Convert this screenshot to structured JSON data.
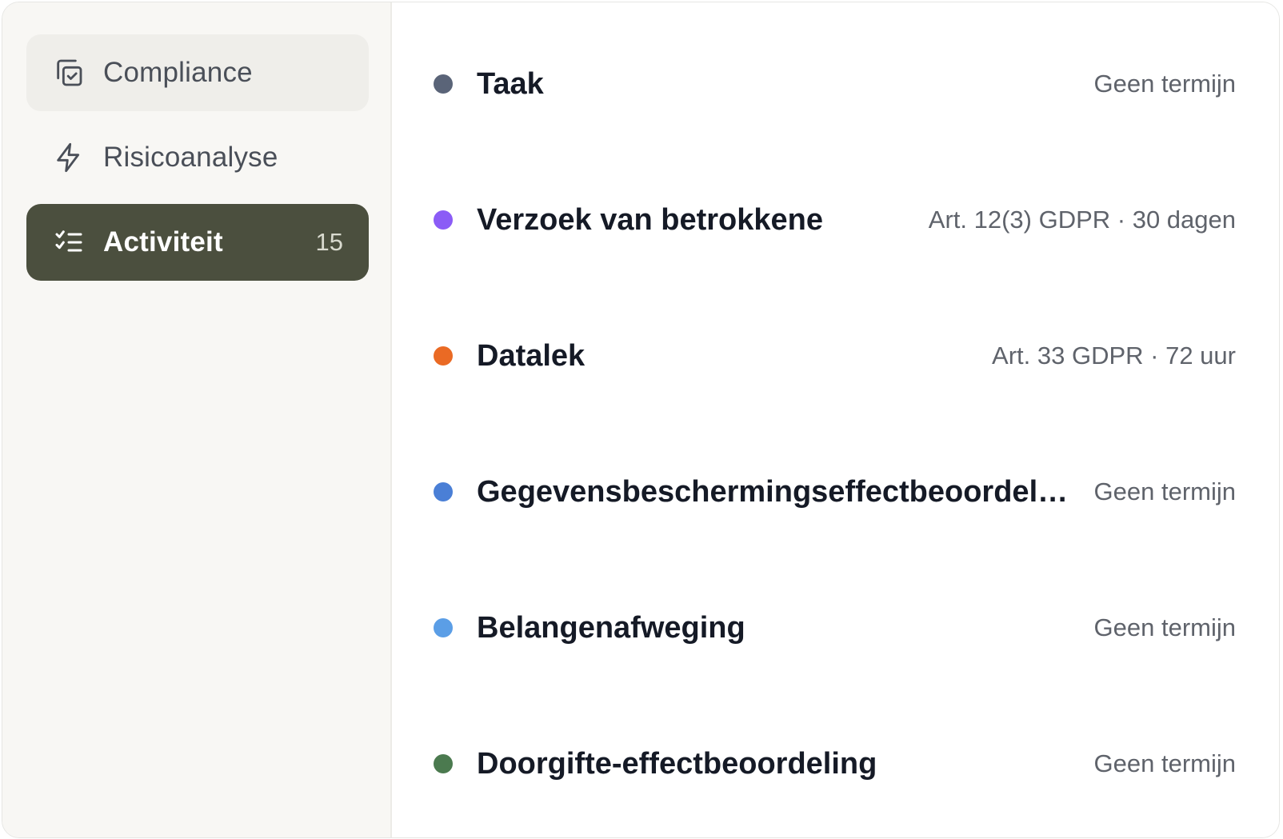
{
  "sidebar": {
    "items": [
      {
        "label": "Compliance",
        "icon": "checklist-copy-icon",
        "state": "hover"
      },
      {
        "label": "Risicoanalyse",
        "icon": "lightning-icon",
        "state": "default"
      },
      {
        "label": "Activiteit",
        "icon": "list-check-icon",
        "state": "active",
        "count": "15"
      }
    ]
  },
  "activity_types": [
    {
      "title": "Taak",
      "meta": "Geen termijn",
      "color": "#5a6478"
    },
    {
      "title": "Verzoek van betrokkene",
      "meta": "Art. 12(3) GDPR · 30 dagen",
      "color": "#8b5cf6"
    },
    {
      "title": "Datalek",
      "meta": "Art. 33 GDPR · 72 uur",
      "color": "#ea6a24"
    },
    {
      "title": "Gegevensbeschermingseffectbeoordeling",
      "meta": "Geen termijn",
      "color": "#4a7fd6"
    },
    {
      "title": "Belangenafweging",
      "meta": "Geen termijn",
      "color": "#5b9ee6"
    },
    {
      "title": "Doorgifte-effectbeoordeling",
      "meta": "Geen termijn",
      "color": "#4b7a4f"
    }
  ]
}
